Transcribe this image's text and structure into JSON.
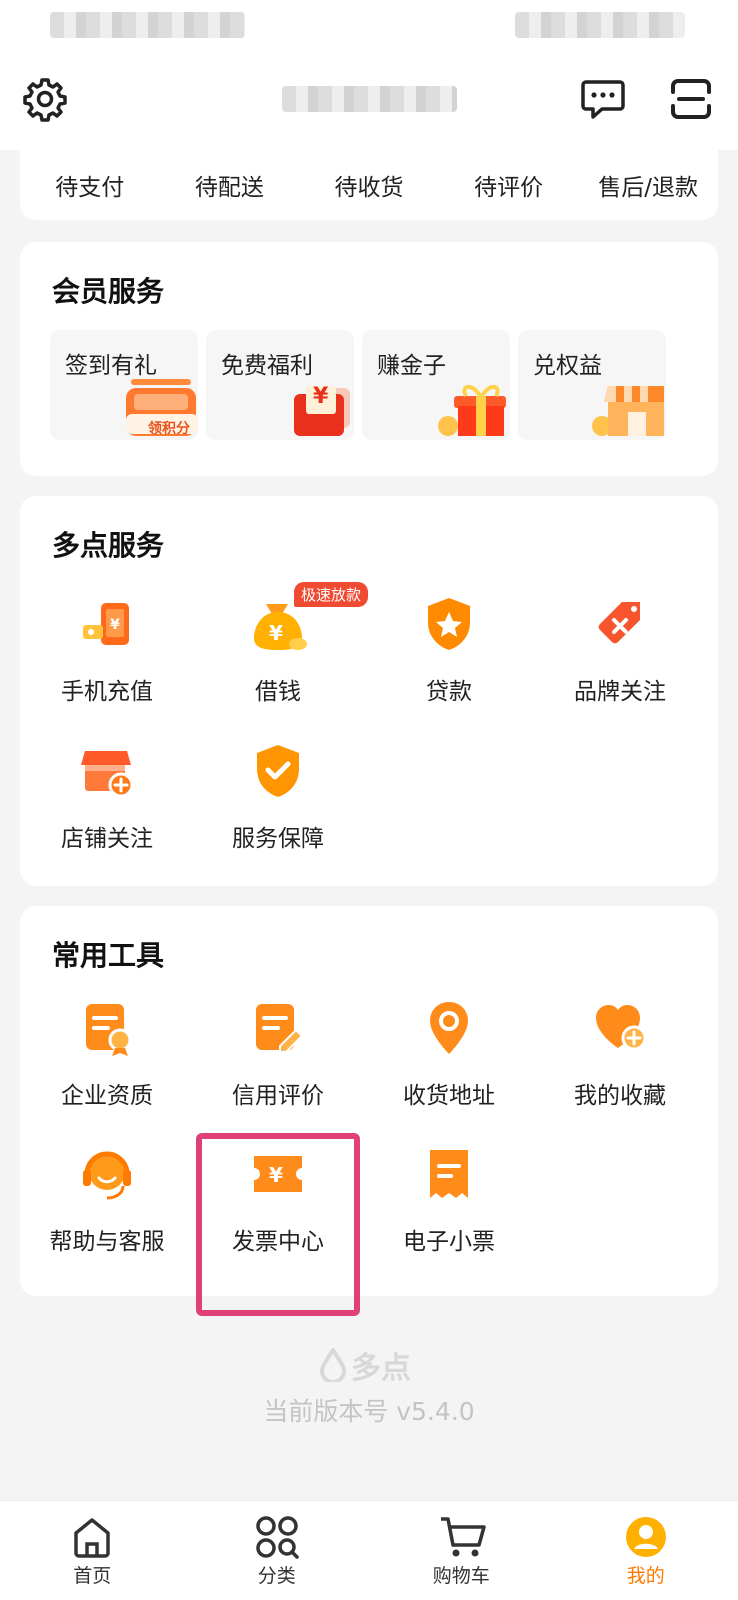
{
  "top_bar": {},
  "orders": [
    "待支付",
    "待配送",
    "待收货",
    "待评价",
    "售后/退款"
  ],
  "member": {
    "title": "会员服务",
    "tiles": [
      {
        "label": "签到有礼",
        "art_text": "领积分"
      },
      {
        "label": "免费福利",
        "art_text": "¥"
      },
      {
        "label": "赚金子"
      },
      {
        "label": "兑权益"
      }
    ]
  },
  "duodian": {
    "title": "多点服务",
    "items": [
      {
        "label": "手机充值",
        "icon": "phone-topup-icon"
      },
      {
        "label": "借钱",
        "icon": "money-bag-icon",
        "badge": "极速放款"
      },
      {
        "label": "贷款",
        "icon": "shield-star-icon"
      },
      {
        "label": "品牌关注",
        "icon": "tag-icon"
      },
      {
        "label": "店铺关注",
        "icon": "store-plus-icon"
      },
      {
        "label": "服务保障",
        "icon": "shield-check-icon"
      }
    ]
  },
  "tools": {
    "title": "常用工具",
    "items": [
      {
        "label": "企业资质",
        "icon": "certificate-icon"
      },
      {
        "label": "信用评价",
        "icon": "document-pen-icon"
      },
      {
        "label": "收货地址",
        "icon": "location-pin-icon"
      },
      {
        "label": "我的收藏",
        "icon": "heart-plus-icon"
      },
      {
        "label": "帮助与客服",
        "icon": "headset-icon"
      },
      {
        "label": "发票中心",
        "icon": "invoice-icon"
      },
      {
        "label": "电子小票",
        "icon": "receipt-icon"
      }
    ]
  },
  "footer": {
    "logo": "多点",
    "version": "当前版本号 v5.4.0"
  },
  "tabbar": [
    {
      "label": "首页",
      "icon": "home-icon"
    },
    {
      "label": "分类",
      "icon": "category-icon"
    },
    {
      "label": "购物车",
      "icon": "cart-icon"
    },
    {
      "label": "我的",
      "icon": "profile-icon",
      "active": true
    }
  ],
  "colors": {
    "accent": "#ff8a00",
    "highlight": "#e0407a",
    "badge": "#f04a32"
  }
}
